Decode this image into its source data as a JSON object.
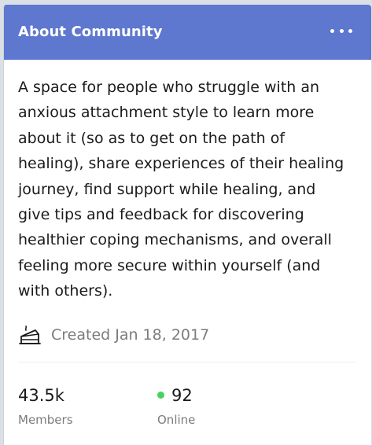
{
  "header": {
    "title": "About Community",
    "more_icon": "more-horizontal-icon",
    "background": "#5e77cf"
  },
  "about": {
    "description": "A space for people who struggle with an anxious attachment style to learn more about it (so as to get on the path of healing), share experiences of their healing journey, find support while healing, and give tips and feedback for discovering healthier coping mechanisms, and overall feeling more secure within yourself (and with others).",
    "created_icon": "cake-icon",
    "created": "Created Jan 18, 2017"
  },
  "stats": {
    "members": {
      "value": "43.5k",
      "label": "Members"
    },
    "online": {
      "value": "92",
      "label": "Online",
      "dot_color": "#46d160"
    }
  }
}
